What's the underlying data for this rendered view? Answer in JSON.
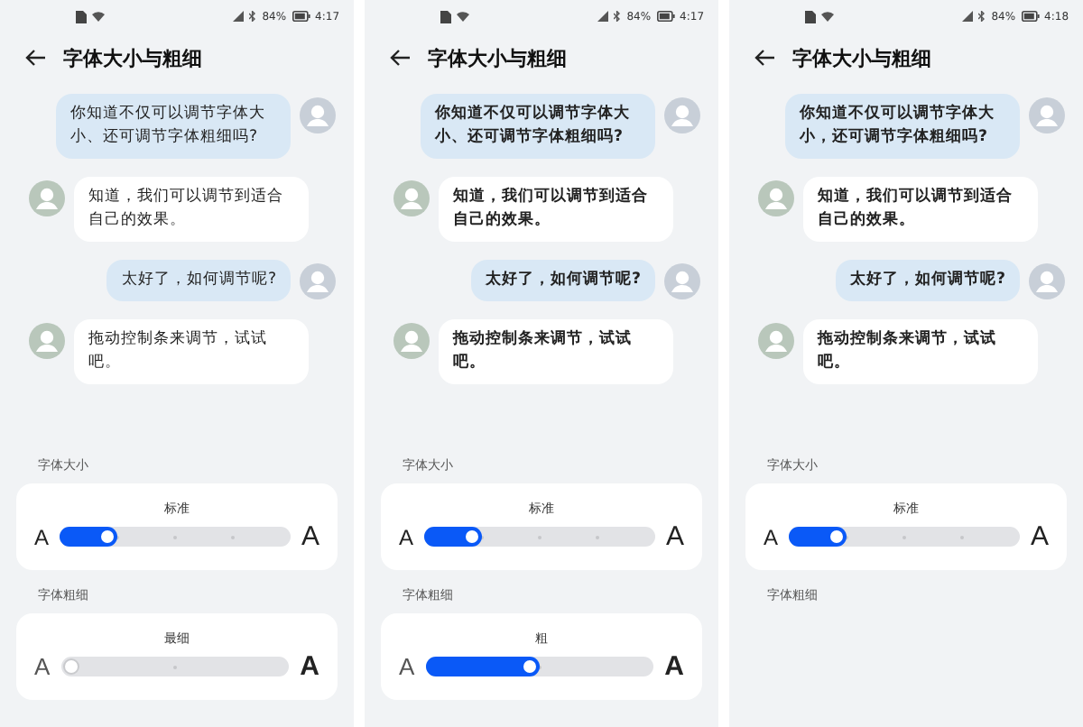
{
  "panels": [
    {
      "status": {
        "battery": "84%",
        "time": "4:17"
      },
      "title": "字体大小与粗细",
      "bold_text": false,
      "messages": [
        {
          "kind": "sent",
          "text": "你知道不仅可以调节字体大小、还可调节字体粗细吗?"
        },
        {
          "kind": "received",
          "text": "知道，我们可以调节到适合自己的效果。"
        },
        {
          "kind": "sent",
          "text": "太好了，如何调节呢?"
        },
        {
          "kind": "received",
          "text": "拖动控制条来调节，试试吧。"
        }
      ],
      "settings": [
        {
          "kind": "size",
          "label": "字体大小",
          "value": "标准",
          "min_label": "A",
          "max_label": "A",
          "level": 0.25
        },
        {
          "kind": "weight",
          "label": "字体粗细",
          "value": "最细",
          "min_label": "A",
          "max_label": "A",
          "level": 0
        }
      ]
    },
    {
      "status": {
        "battery": "84%",
        "time": "4:17"
      },
      "title": "字体大小与粗细",
      "bold_text": true,
      "messages": [
        {
          "kind": "sent",
          "text": "你知道不仅可以调节字体大小、还可调节字体粗细吗?"
        },
        {
          "kind": "received",
          "text": "知道，我们可以调节到适合自己的效果。"
        },
        {
          "kind": "sent",
          "text": "太好了，如何调节呢?"
        },
        {
          "kind": "received",
          "text": "拖动控制条来调节，试试吧。"
        }
      ],
      "settings": [
        {
          "kind": "size",
          "label": "字体大小",
          "value": "标准",
          "min_label": "A",
          "max_label": "A",
          "level": 0.25
        },
        {
          "kind": "weight",
          "label": "字体粗细",
          "value": "粗",
          "min_label": "A",
          "max_label": "A",
          "level": 0.5
        }
      ]
    },
    {
      "status": {
        "battery": "84%",
        "time": "4:18"
      },
      "title": "字体大小与粗细",
      "bold_text": true,
      "messages": [
        {
          "kind": "sent",
          "text": "你知道不仅可以调节字体大小，还可调节字体粗细吗?"
        },
        {
          "kind": "received",
          "text": "知道，我们可以调节到适合自己的效果。"
        },
        {
          "kind": "sent",
          "text": "太好了，如何调节呢?"
        },
        {
          "kind": "received",
          "text": "拖动控制条来调节，试试吧。"
        }
      ],
      "settings": [
        {
          "kind": "size",
          "label": "字体大小",
          "value": "标准",
          "min_label": "A",
          "max_label": "A",
          "level": 0.25
        },
        {
          "kind": "weight",
          "label": "字体粗细"
        }
      ]
    }
  ]
}
